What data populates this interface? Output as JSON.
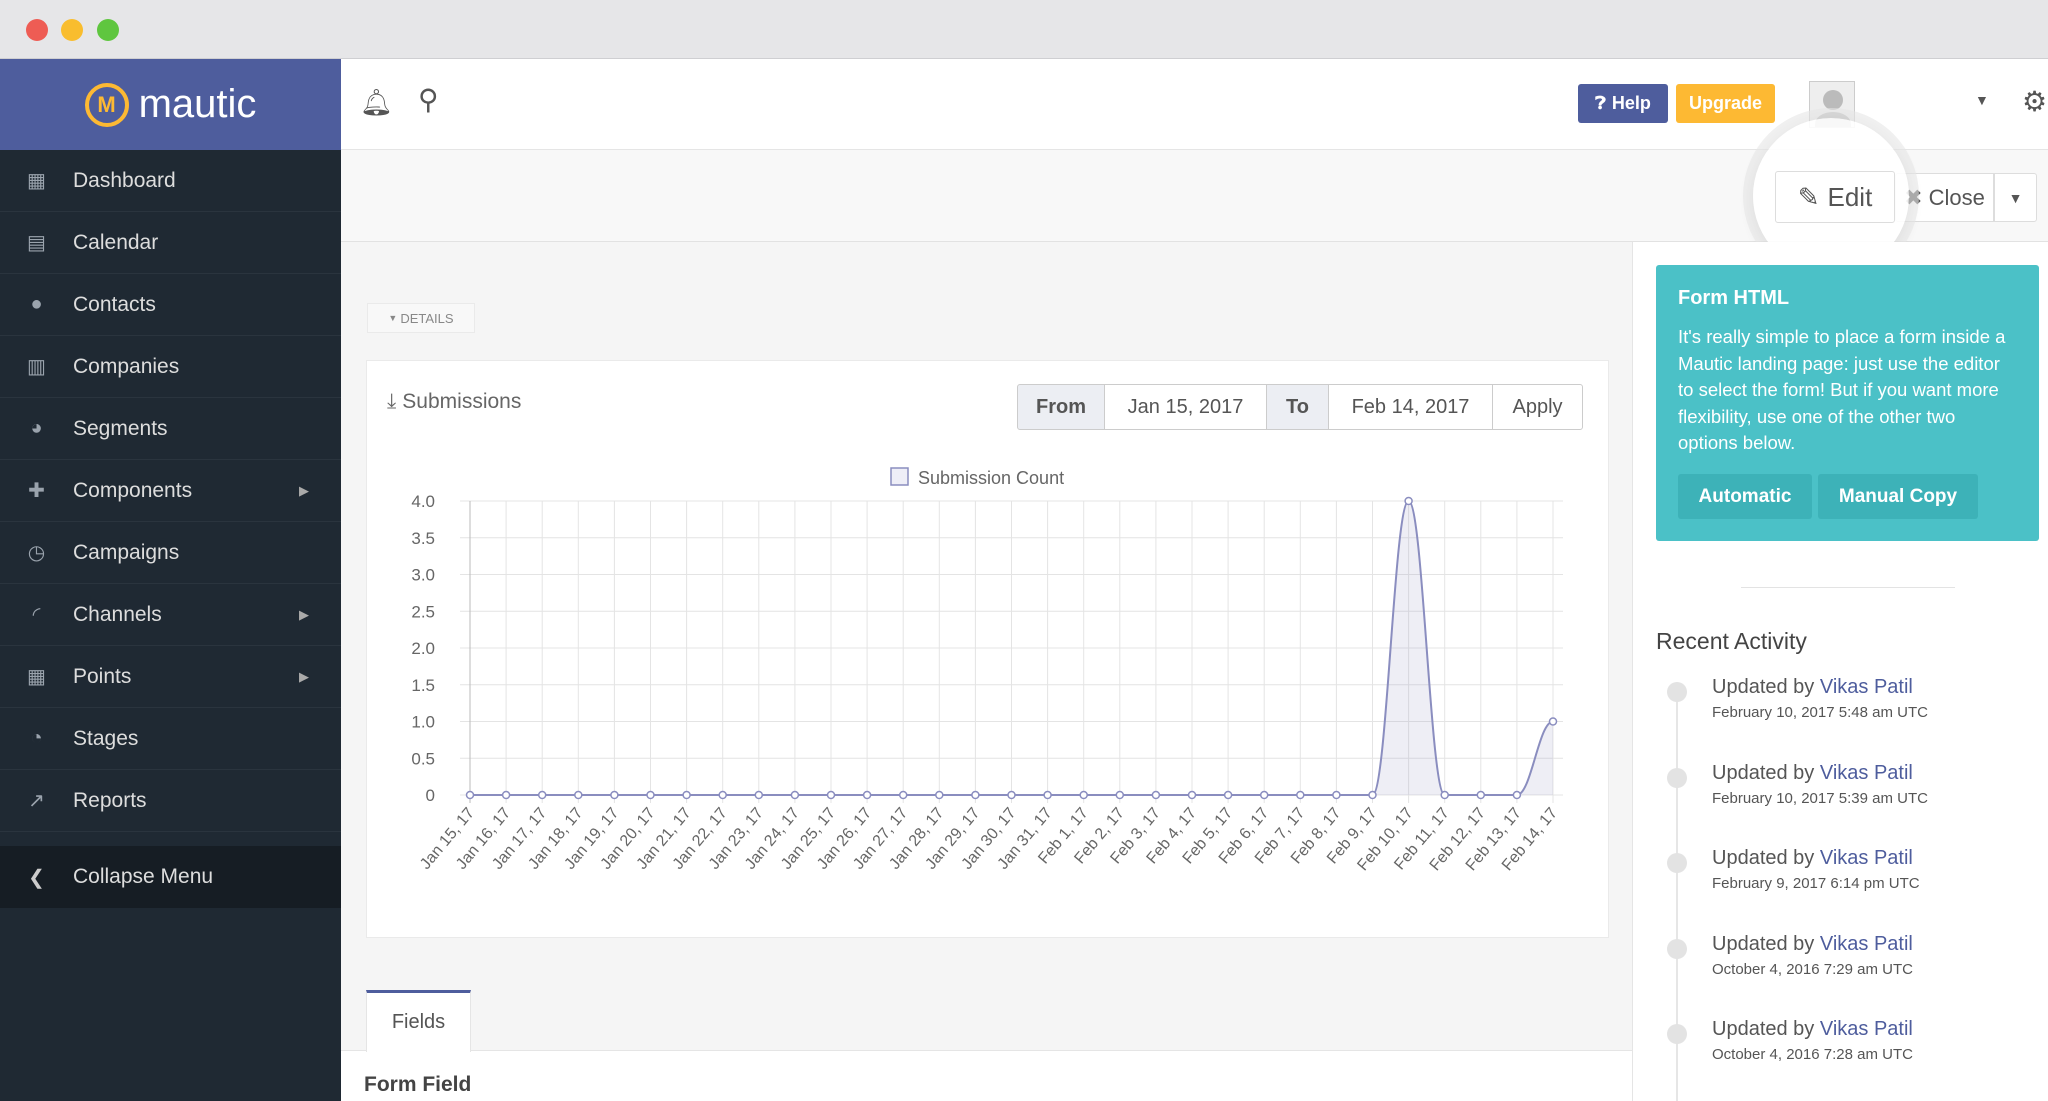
{
  "window": {
    "traffic_lights": [
      "#ee5c54",
      "#f9bd2e",
      "#5fc63f"
    ]
  },
  "sidebar": {
    "logo": "mautic",
    "items": [
      {
        "label": "Dashboard",
        "icon": "dashboard-icon",
        "glyph": "▦"
      },
      {
        "label": "Calendar",
        "icon": "calendar-icon",
        "glyph": "▤"
      },
      {
        "label": "Contacts",
        "icon": "user-icon",
        "glyph": "●"
      },
      {
        "label": "Companies",
        "icon": "building-icon",
        "glyph": "▥"
      },
      {
        "label": "Segments",
        "icon": "pie-chart-icon",
        "glyph": "◕"
      },
      {
        "label": "Components",
        "icon": "puzzle-icon",
        "glyph": "✚",
        "submenu": true
      },
      {
        "label": "Campaigns",
        "icon": "clock-icon",
        "glyph": "◷"
      },
      {
        "label": "Channels",
        "icon": "rss-icon",
        "glyph": "◜"
      },
      {
        "label": "Points",
        "icon": "calculator-icon",
        "glyph": "▦",
        "submenu": true
      },
      {
        "label": "Stages",
        "icon": "tachometer-icon",
        "glyph": "◔"
      },
      {
        "label": "Reports",
        "icon": "line-chart-icon",
        "glyph": "↗"
      }
    ],
    "collapse": "Collapse Menu"
  },
  "header": {
    "help": "Help",
    "upgrade": "Upgrade"
  },
  "toolbar": {
    "edit": "Edit",
    "close": "Close"
  },
  "details_tab": "DETAILS",
  "submissions": {
    "title": "Submissions",
    "from_label": "From",
    "from_value": "Jan 15, 2017",
    "to_label": "To",
    "to_value": "Feb 14, 2017",
    "apply": "Apply"
  },
  "chart_data": {
    "type": "line",
    "legend": "Submission Count",
    "legend_position": "top",
    "grid": true,
    "ylim": [
      0,
      4
    ],
    "yticks": [
      "0",
      "0.5",
      "1.0",
      "1.5",
      "2.0",
      "2.5",
      "3.0",
      "3.5",
      "4.0"
    ],
    "categories": [
      "Jan 15, 17",
      "Jan 16, 17",
      "Jan 17, 17",
      "Jan 18, 17",
      "Jan 19, 17",
      "Jan 20, 17",
      "Jan 21, 17",
      "Jan 22, 17",
      "Jan 23, 17",
      "Jan 24, 17",
      "Jan 25, 17",
      "Jan 26, 17",
      "Jan 27, 17",
      "Jan 28, 17",
      "Jan 29, 17",
      "Jan 30, 17",
      "Jan 31, 17",
      "Feb 1, 17",
      "Feb 2, 17",
      "Feb 3, 17",
      "Feb 4, 17",
      "Feb 5, 17",
      "Feb 6, 17",
      "Feb 7, 17",
      "Feb 8, 17",
      "Feb 9, 17",
      "Feb 10, 17",
      "Feb 11, 17",
      "Feb 12, 17",
      "Feb 13, 17",
      "Feb 14, 17"
    ],
    "values": [
      0,
      0,
      0,
      0,
      0,
      0,
      0,
      0,
      0,
      0,
      0,
      0,
      0,
      0,
      0,
      0,
      0,
      0,
      0,
      0,
      0,
      0,
      0,
      0,
      0,
      0,
      4,
      0,
      0,
      0,
      1
    ],
    "color": "#8a8dbf"
  },
  "fields_tab": "Fields",
  "form_field": "Form Field",
  "form_html": {
    "title": "Form HTML",
    "text": "It's really simple to place a form inside a Mautic landing page: just use the editor to select the form! But if you want more flexibility, use one of the other two options below.",
    "automatic": "Automatic",
    "manual": "Manual Copy"
  },
  "recent_activity": {
    "title": "Recent Activity",
    "items": [
      {
        "prefix": "Updated by",
        "user": "Vikas Patil",
        "date": "February 10, 2017 5:48 am UTC"
      },
      {
        "prefix": "Updated by",
        "user": "Vikas Patil",
        "date": "February 10, 2017 5:39 am UTC"
      },
      {
        "prefix": "Updated by",
        "user": "Vikas Patil",
        "date": "February 9, 2017 6:14 pm UTC"
      },
      {
        "prefix": "Updated by",
        "user": "Vikas Patil",
        "date": "October 4, 2016 7:29 am UTC"
      },
      {
        "prefix": "Updated by",
        "user": "Vikas Patil",
        "date": "October 4, 2016 7:28 am UTC"
      }
    ]
  }
}
